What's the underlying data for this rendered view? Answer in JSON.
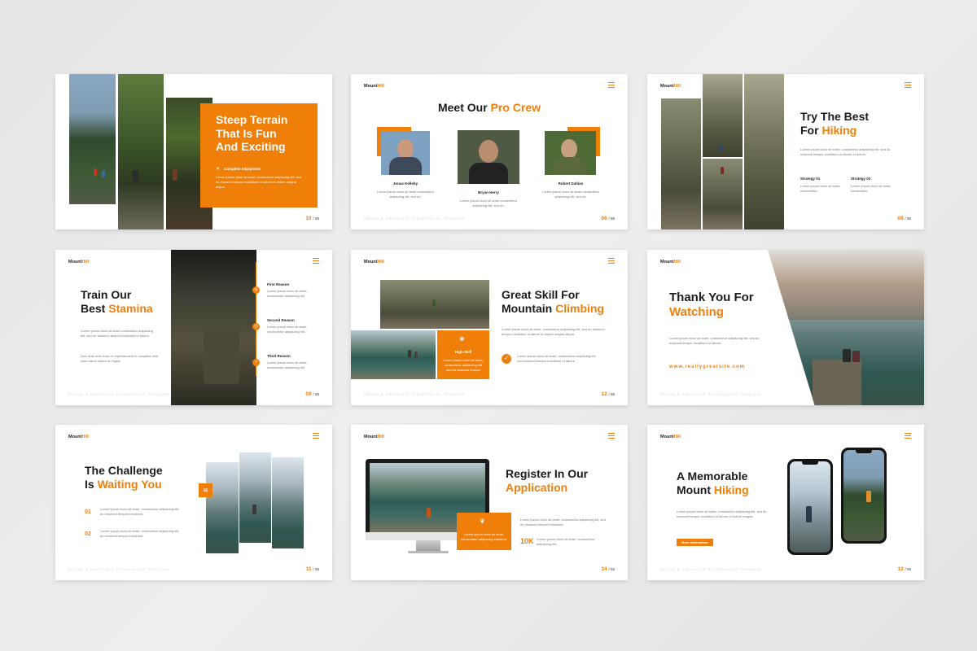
{
  "brand": {
    "logo_main": "Mount",
    "logo_accent": "Hill",
    "accent_color": "#f07f0a"
  },
  "watermark": "Hiking & Adventure Presentation Template",
  "lorem_short": "Lorem ipsum dolor sit amet, consectetur adipiscing elit, do eiusmod tempor.",
  "lorem_long": "Lorem ipsum dolor sit amet, consectetur adipiscing elit, sed do eiusmod tempor incididunt ut labore et dolore magna aliqua.",
  "slides": [
    {
      "title_l1": "Steep Terrain",
      "title_l2": "That Is Fun",
      "title_l3": "And Exciting",
      "feature": "Complete Equipment",
      "text": "Lorem ipsum dolor sit amet, consectetur adipiscing elit, sed do eiusmod tempor incididunt ut labore et dolore magna aliqua.",
      "page": "10",
      "total": "55"
    },
    {
      "title": "Meet Our",
      "title_accent": "Pro Crew",
      "members": [
        {
          "name": "Jonas Kelleby",
          "text": "Lorem ipsum dolor sit amet consectetur adipiscing elit, sed do."
        },
        {
          "name": "Bryan Herry",
          "text": "Lorem ipsum dolor sit amet consectetur adipiscing elit, sed do."
        },
        {
          "name": "Robert Dahlan",
          "text": "Lorem ipsum dolor sit amet consectetur adipiscing elit, sed do."
        }
      ],
      "page": "06",
      "total": "55"
    },
    {
      "title_l1": "Try The Best",
      "title_l2a": "For",
      "title_accent": "Hiking",
      "text": "Lorem ipsum dolor sit amet, consectetur adipiscing elit, sed do eiusmod tempor incididunt ut labore et dolore.",
      "strategies": [
        {
          "label": "Strategy 01",
          "text": "Lorem ipsum dolor sit amet, consectetur."
        },
        {
          "label": "Strategy 02",
          "text": "Lorem ipsum dolor sit amet, consectetur."
        }
      ],
      "page": "08",
      "total": "55"
    },
    {
      "title_l1": "Train Our",
      "title_l2a": "Best",
      "title_accent": "Stamina",
      "text1": "Lorem ipsum dolor sit amet consectetur adipiscing elit, sed do eiusmod tempor incididunt ut labore.",
      "text2": "Duis aute irure dolor in reprehenderit in voluptate velit esse cillum dolore eu fugiat.",
      "reasons": [
        {
          "label": "First Reason",
          "text": "Lorem ipsum dolor sit amet, consectetur adipiscing elit."
        },
        {
          "label": "Second Reason",
          "text": "Lorem ipsum dolor sit amet, consectetur adipiscing elit."
        },
        {
          "label": "Third Reason",
          "text": "Lorem ipsum dolor sit amet, consectetur adipiscing elit."
        }
      ],
      "page": "09",
      "total": "55"
    },
    {
      "title_l1": "Great Skill For",
      "title_l2a": "Mountain",
      "title_accent": "Climbing",
      "text": "Lorem ipsum dolor sit amet, consectetur adipiscing elit, sed do eiusmod tempor incididunt ut labore et dolore magna aliqua.",
      "check_text": "Lorem ipsum dolor sit amet, consectetur adipiscing elit, sed eiusmod tempor incididunt ut labore.",
      "box_label": "High Skill",
      "box_text": "Lorem ipsum dolor sit amet, consectetur adipiscing elit sed do eiusmod tempor",
      "page": "12",
      "total": "55"
    },
    {
      "title_l1": "Thank You For",
      "title_accent": "Watching",
      "text": "Lorem ipsum dolor sit amet, consectetur adipiscing elit, sed do eiusmod tempor incididunt ut labore.",
      "url": "www.reallygreatsite.com"
    },
    {
      "title_l1": "The Challenge",
      "title_l2a": "Is",
      "title_accent": "Waiting You",
      "items": [
        {
          "num": "01",
          "text": "Lorem ipsum dolor sit amet, consectetur adipiscing elit, do eiusmod tempor incididunt."
        },
        {
          "num": "02",
          "text": "Lorem ipsum dolor sit amet, consectetur adipiscing elit, do eiusmod tempor incididunt."
        }
      ],
      "page": "11",
      "total": "55"
    },
    {
      "title_l1": "Register In Our",
      "title_accent": "Application",
      "text": "Lorem ipsum dolor sit amet, consectetur adipiscing elit, sed do eiusmod tempor incididunt.",
      "stat": "10K",
      "stat_text": "Lorem ipsum dolor sit amet, consectetur adipiscing elit.",
      "box_text": "Lorem ipsum dolor sit amet, consectetur adipiscing eiusmod.",
      "page": "14",
      "total": "55"
    },
    {
      "title_l1": "A Memorable",
      "title_l2a": "Mount",
      "title_accent": "Hiking",
      "text": "Lorem ipsum dolor sit amet, consectetur adipiscing elit, sed do eiusmod tempor incididunt ut labore et dolore magna.",
      "button": "More Information",
      "page": "13",
      "total": "55"
    }
  ]
}
